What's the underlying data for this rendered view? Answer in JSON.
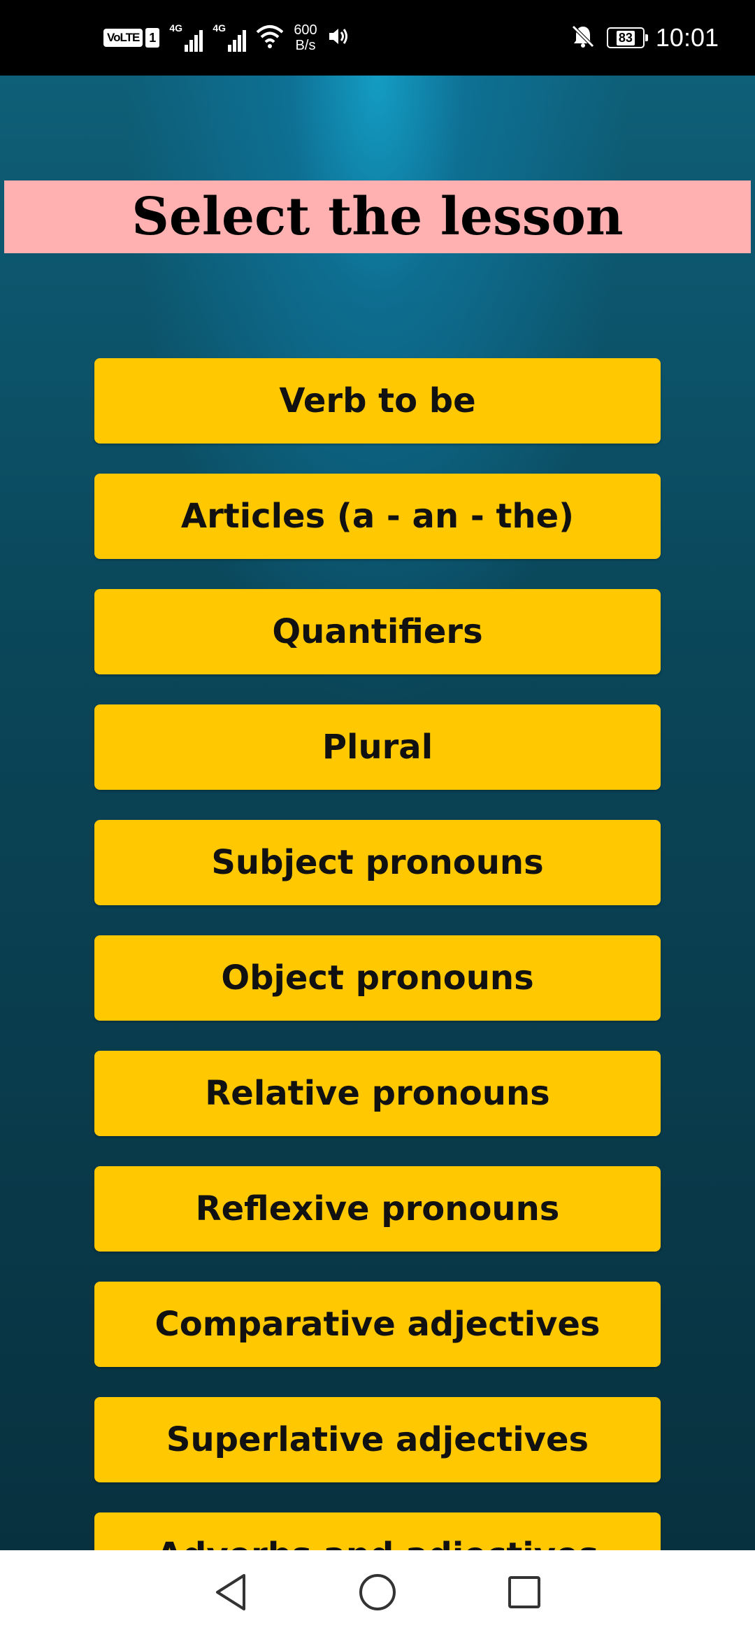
{
  "status_bar": {
    "volte": "VoLTE",
    "sim": "1",
    "network1": "4G",
    "network2": "4G",
    "speed_value": "600",
    "speed_unit": "B/s",
    "battery": "83",
    "time": "10:01"
  },
  "page": {
    "title": "Select the lesson"
  },
  "lessons": [
    "Verb to be",
    "Articles (a - an - the)",
    "Quantifiers",
    "Plural",
    "Subject pronouns",
    "Object pronouns",
    "Relative pronouns",
    "Reflexive pronouns",
    "Comparative adjectives",
    "Superlative adjectives",
    "Adverbs and adjectives"
  ],
  "colors": {
    "button": "#ffc800",
    "banner": "#ffb1b1"
  },
  "icons": {
    "back": "back-triangle-icon",
    "home": "home-circle-icon",
    "recents": "recents-square-icon"
  }
}
